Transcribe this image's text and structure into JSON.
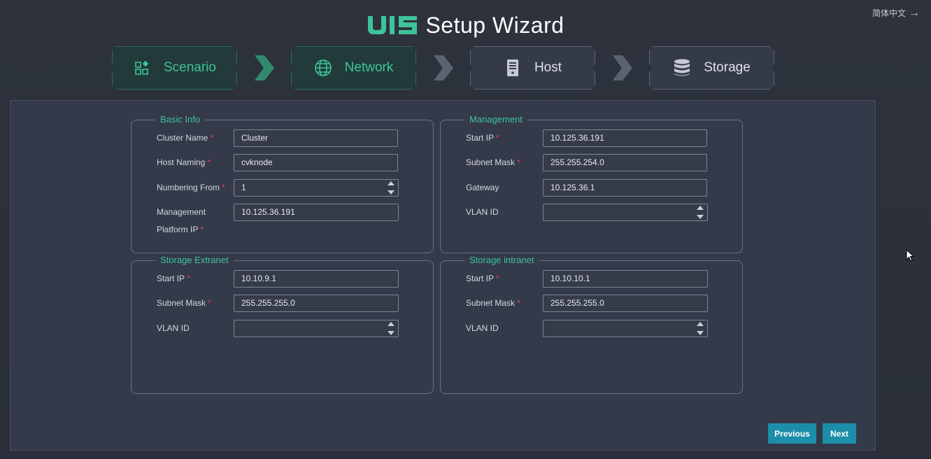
{
  "lang_switch": "简体中文",
  "header": {
    "logo_text": "UIS",
    "title": "Setup Wizard"
  },
  "steps": [
    {
      "label": "Scenario",
      "icon": "scenario-icon",
      "state": "done"
    },
    {
      "label": "Network",
      "icon": "globe-icon",
      "state": "active"
    },
    {
      "label": "Host",
      "icon": "server-icon",
      "state": "pending"
    },
    {
      "label": "Storage",
      "icon": "database-icon",
      "state": "pending"
    }
  ],
  "sections": {
    "basic": {
      "legend": "Basic Info",
      "cluster_name_label": "Cluster Name",
      "cluster_name": "Cluster",
      "host_naming_label": "Host Naming",
      "host_naming": "cvknode",
      "numbering_from_label": "Numbering From",
      "numbering_from": "1",
      "mgmt_ip_label_1": "Management",
      "mgmt_ip_label_2": "Platform IP",
      "mgmt_ip": "10.125.36.191"
    },
    "management": {
      "legend": "Management",
      "start_ip_label": "Start IP",
      "start_ip": "10.125.36.191",
      "subnet_mask_label": "Subnet Mask",
      "subnet_mask": "255.255.254.0",
      "gateway_label": "Gateway",
      "gateway": "10.125.36.1",
      "vlan_label": "VLAN ID",
      "vlan": ""
    },
    "storage_extranet": {
      "legend": "Storage Extranet",
      "start_ip_label": "Start IP",
      "start_ip": "10.10.9.1",
      "subnet_mask_label": "Subnet Mask",
      "subnet_mask": "255.255.255.0",
      "vlan_label": "VLAN ID",
      "vlan": ""
    },
    "storage_intranet": {
      "legend": "Storage intranet",
      "start_ip_label": "Start IP",
      "start_ip": "10.10.10.1",
      "subnet_mask_label": "Subnet Mask",
      "subnet_mask": "255.255.255.0",
      "vlan_label": "VLAN ID",
      "vlan": ""
    }
  },
  "buttons": {
    "previous": "Previous",
    "next": "Next"
  },
  "colors": {
    "accent": "#3ec39a",
    "required": "#e0404a",
    "button": "#1d8eaa",
    "panel": "#343a4a",
    "background": "#2c313c"
  }
}
